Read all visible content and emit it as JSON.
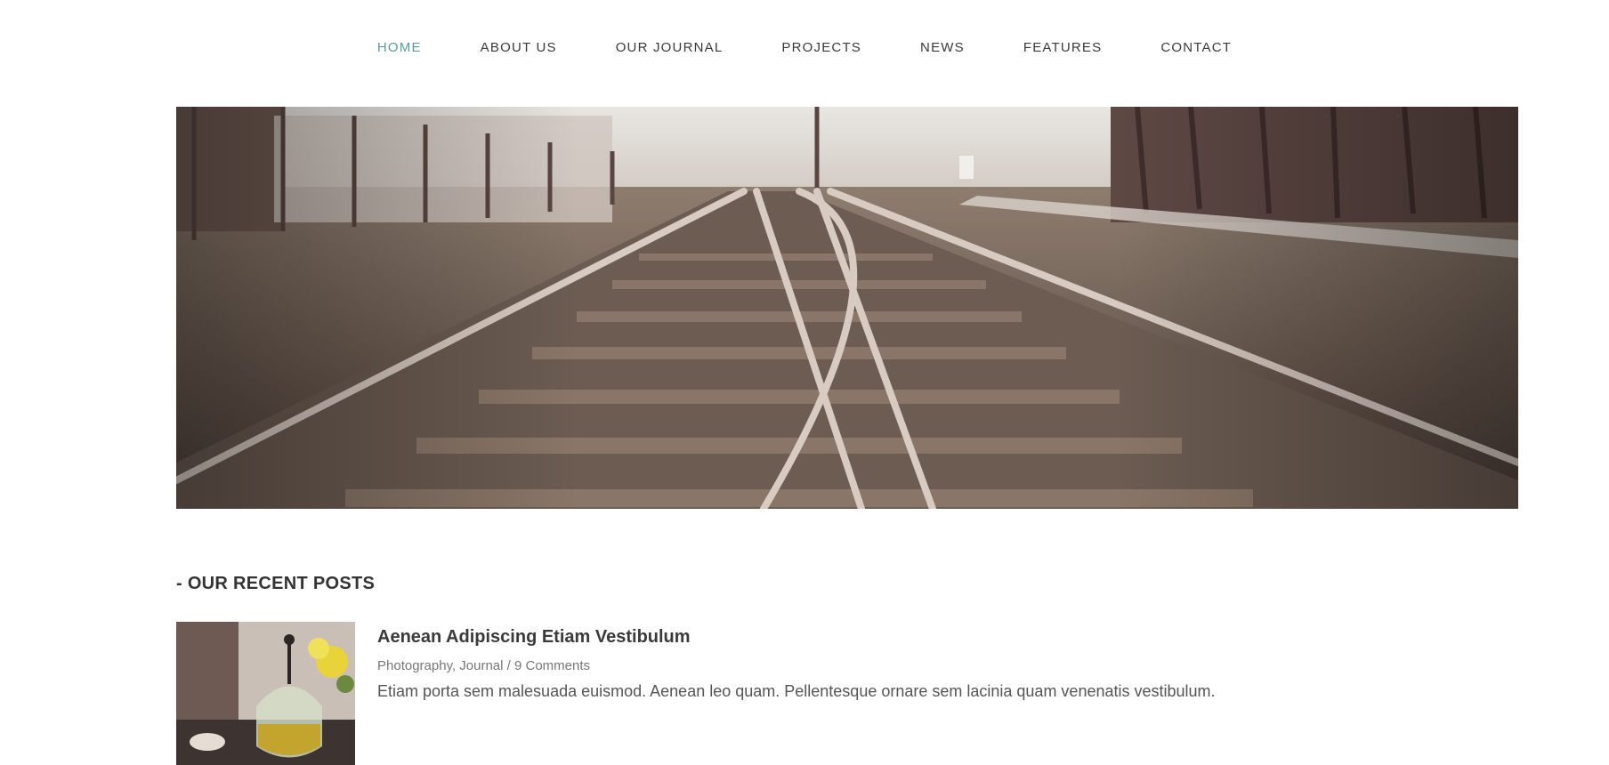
{
  "nav": {
    "items": [
      {
        "label": "HOME",
        "active": true
      },
      {
        "label": "ABOUT US",
        "active": false
      },
      {
        "label": "OUR JOURNAL",
        "active": false
      },
      {
        "label": "PROJECTS",
        "active": false
      },
      {
        "label": "NEWS",
        "active": false
      },
      {
        "label": "FEATURES",
        "active": false
      },
      {
        "label": "CONTACT",
        "active": false
      }
    ],
    "active_color": "#5b9aa0"
  },
  "hero": {
    "image": "railway-tracks-photo"
  },
  "recent_posts": {
    "heading": "- OUR RECENT POSTS",
    "posts": [
      {
        "title": "Aenean Adipiscing Etiam Vestibulum",
        "categories": "Photography, Journal",
        "separator": " / ",
        "comments": "9 Comments",
        "excerpt": "Etiam porta sem malesuada euismod. Aenean leo quam. Pellentesque ornare sem lacinia quam venenatis vestibulum.",
        "thumbnail": "teapot-photo"
      }
    ]
  }
}
